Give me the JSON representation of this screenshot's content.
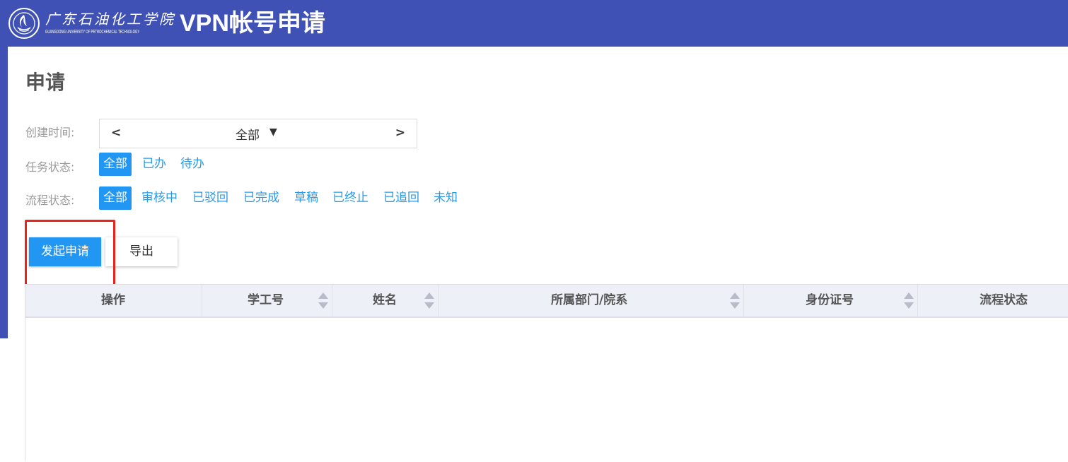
{
  "header": {
    "logo_cn": "广东石油化工学院",
    "logo_en": "GUANGDONG UNIVERSITY OF PETROCHEMICAL TECHNOLOGY",
    "app_title": "VPN帐号申请",
    "background_color": "#3f51b5"
  },
  "page": {
    "title": "申请"
  },
  "filters": {
    "create_time": {
      "label": "创建时间:",
      "value": "全部",
      "prev": "<",
      "next": ">"
    },
    "task_status": {
      "label": "任务状态:",
      "options": [
        "全部",
        "已办",
        "待办"
      ],
      "selected": "全部"
    },
    "process_status": {
      "label": "流程状态:",
      "options": [
        "全部",
        "审核中",
        "已驳回",
        "已完成",
        "草稿",
        "已终止",
        "已追回",
        "未知"
      ],
      "selected": "全部"
    }
  },
  "toolbar": {
    "start_label": "发起申请",
    "export_label": "导出"
  },
  "table": {
    "columns": [
      {
        "label": "操作",
        "sortable": false
      },
      {
        "label": "学工号",
        "sortable": true
      },
      {
        "label": "姓名",
        "sortable": true
      },
      {
        "label": "所属部门/院系",
        "sortable": true
      },
      {
        "label": "身份证号",
        "sortable": true
      },
      {
        "label": "流程状态",
        "sortable": false
      }
    ],
    "rows": []
  },
  "colors": {
    "accent": "#2196f3",
    "highlight": "#e8231a",
    "link": "#2b9ae6"
  },
  "icons": [
    "university-logo-icon",
    "sort-up-icon",
    "sort-down-icon",
    "caret-down-icon"
  ]
}
